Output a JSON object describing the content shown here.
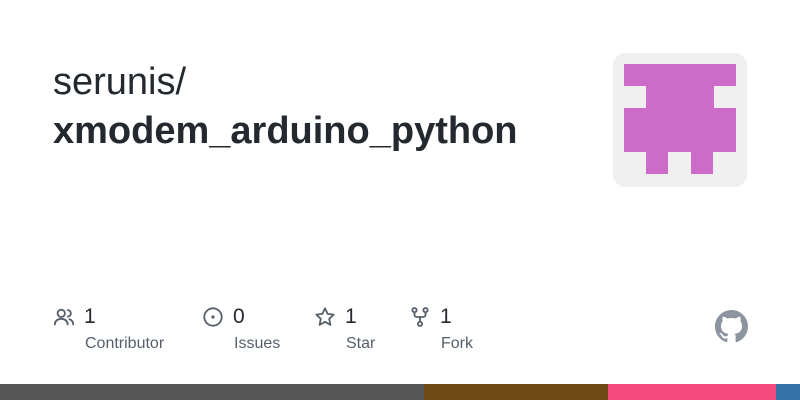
{
  "repo": {
    "owner": "serunis/",
    "name": "xmodem_arduino_python"
  },
  "stats": [
    {
      "count": "1",
      "label": "Contributor",
      "icon": "people-icon"
    },
    {
      "count": "0",
      "label": "Issues",
      "icon": "issue-opened-icon"
    },
    {
      "count": "1",
      "label": "Star",
      "icon": "star-icon"
    },
    {
      "count": "1",
      "label": "Fork",
      "icon": "repo-forked-icon"
    }
  ],
  "colors": {
    "avatar_fg": "#cc6bc8",
    "avatar_bg": "#f0f0f0",
    "icon": "#57606a",
    "lang_1": "#555555",
    "lang_2": "#6e4c13",
    "lang_3": "#f34b7d",
    "lang_4": "#3572a5"
  },
  "language_bar": [
    {
      "color": "#555555",
      "fraction": 0.53
    },
    {
      "color": "#6e4c13",
      "fraction": 0.23
    },
    {
      "color": "#f34b7d",
      "fraction": 0.21
    },
    {
      "color": "#3572a5",
      "fraction": 0.03
    }
  ]
}
